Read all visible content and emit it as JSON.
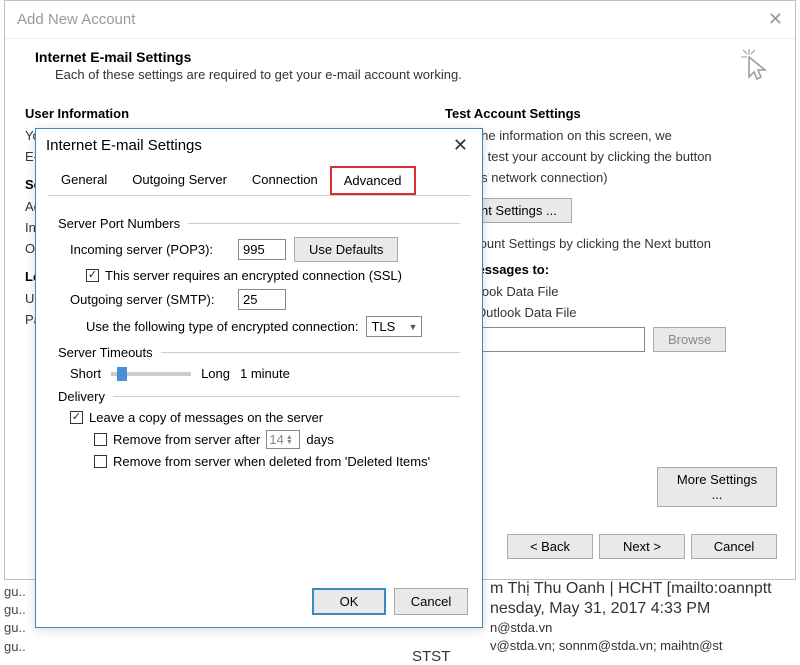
{
  "main": {
    "title": "Add New Account",
    "wizard_title": "Internet E-mail Settings",
    "wizard_subtitle": "Each of these settings are required to get your e-mail account working.",
    "left": {
      "user_info": "User Information",
      "yo": "Yo",
      "em": "E-m",
      "se": "Se",
      "ac": "Ac",
      "inc": "Inc",
      "ou": "Ou",
      "lo": "Lo",
      "u": "U",
      "pa": "Pa"
    },
    "right": {
      "test_title": "Test Account Settings",
      "test_text1": "g out the information on this screen, we",
      "test_text2": "nd you test your account by clicking the button",
      "test_text3": "equires network connection)",
      "test_btn": "count Settings ...",
      "auto_test": "st Account Settings by clicking the Next button",
      "deliver_title": "ew messages to:",
      "new_file": "w Outlook Data File",
      "existing_file": "sting Outlook Data File",
      "browse_btn": "Browse",
      "more_btn": "More Settings ..."
    },
    "buttons": {
      "back": "< Back",
      "next": "Next >",
      "cancel": "Cancel"
    }
  },
  "sub": {
    "title": "Internet E-mail Settings",
    "tabs": {
      "general": "General",
      "outgoing": "Outgoing Server",
      "connection": "Connection",
      "advanced": "Advanced"
    },
    "ports": {
      "section": "Server Port Numbers",
      "incoming_label": "Incoming server (POP3):",
      "incoming_value": "995",
      "defaults_btn": "Use Defaults",
      "ssl_check": "This server requires an encrypted connection (SSL)",
      "outgoing_label": "Outgoing server (SMTP):",
      "outgoing_value": "25",
      "encrypt_label": "Use the following type of encrypted connection:",
      "encrypt_value": "TLS"
    },
    "timeouts": {
      "section": "Server Timeouts",
      "short": "Short",
      "long": "Long",
      "duration": "1 minute"
    },
    "delivery": {
      "section": "Delivery",
      "leave_copy": "Leave a copy of messages on the server",
      "remove_after": "Remove from server after",
      "days_value": "14",
      "days_unit": "days",
      "remove_deleted": "Remove from server when deleted from 'Deleted Items'"
    },
    "buttons": {
      "ok": "OK",
      "cancel": "Cancel"
    }
  },
  "bg": {
    "sender1": "gu..",
    "sender2": "gu..",
    "sender3": "gu..",
    "sender4": "gu..",
    "name_line": "m Thị Thu Oanh | HCHT [mailto:oannptt",
    "date_line": "nesday, May 31, 2017 4:33 PM",
    "email1": "n@stda.vn",
    "email2": "v@stda.vn; sonnm@stda.vn; maihtn@st",
    "subj": "STST"
  }
}
